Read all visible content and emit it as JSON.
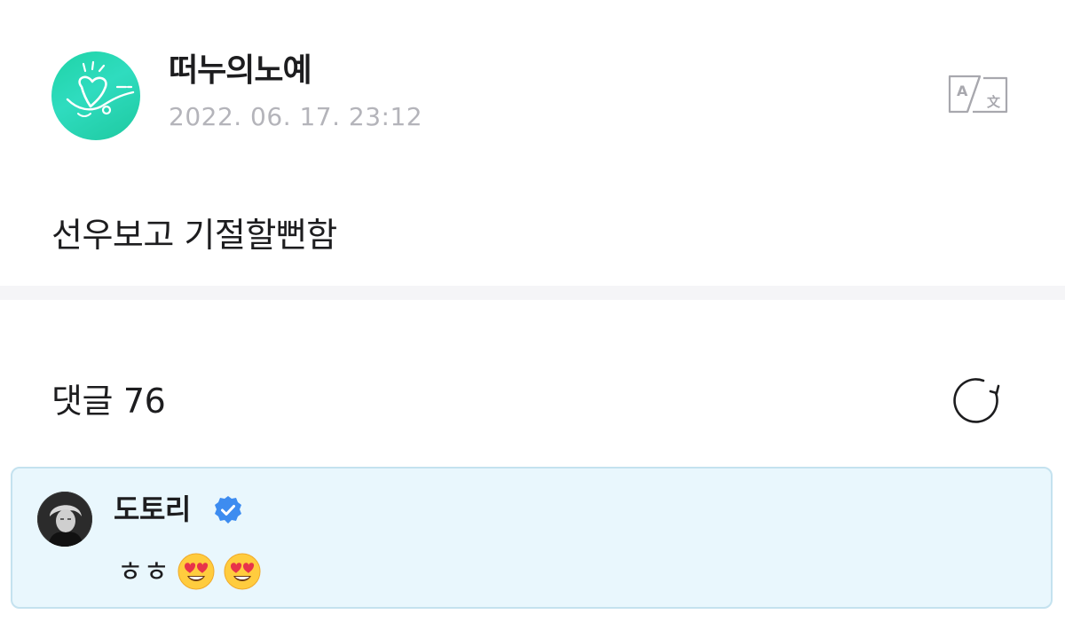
{
  "post": {
    "author_name": "떠누의노예",
    "date": "2022. 06. 17. 23:12",
    "body": "선우보고 기절할뻔함",
    "avatar_icon": "profile-avatar-heart-doodle",
    "translate_icon": "translate-icon"
  },
  "comments": {
    "label": "댓글",
    "count": "76",
    "refresh_icon": "refresh-icon",
    "items": [
      {
        "author": "도토리",
        "verified": true,
        "text": "ㅎㅎ",
        "emojis": [
          "heart-eyes-emoji",
          "heart-eyes-emoji"
        ]
      }
    ]
  },
  "colors": {
    "accent_mint": "#1fd3a6",
    "date_gray": "#b4b4ba",
    "comment_bg": "#e9f7fd",
    "comment_border": "#c4e2ef",
    "verified_blue": "#3d8cf0",
    "divider": "#f5f5f7"
  }
}
